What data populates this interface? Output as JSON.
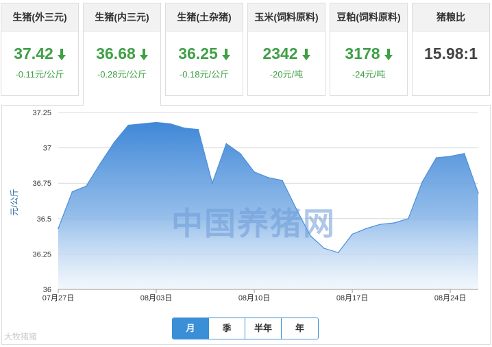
{
  "tiles": [
    {
      "label": "生猪(外三元)",
      "value": "37.42",
      "change": "-0.11元/公斤",
      "trend": "down"
    },
    {
      "label": "生猪(内三元)",
      "value": "36.68",
      "change": "-0.28元/公斤",
      "trend": "down",
      "active": true
    },
    {
      "label": "生猪(土杂猪)",
      "value": "36.25",
      "change": "-0.18元/公斤",
      "trend": "down"
    },
    {
      "label": "玉米(饲料原料)",
      "value": "2342",
      "change": "-20元/吨",
      "trend": "down"
    },
    {
      "label": "豆粕(饲料原料)",
      "value": "3178",
      "change": "-24元/吨",
      "trend": "down"
    },
    {
      "label": "猪粮比",
      "value": "15.98:1"
    }
  ],
  "colors": {
    "up_down_green": "#3fa046",
    "series_line": "#4a8fd8",
    "button_accent": "#3a8fd6"
  },
  "range_buttons": [
    {
      "label": "月",
      "active": true
    },
    {
      "label": "季",
      "active": false
    },
    {
      "label": "半年",
      "active": false
    },
    {
      "label": "年",
      "active": false
    }
  ],
  "watermark": "中国养猪网",
  "credit": "大牧猪猪",
  "chart_data": {
    "type": "area",
    "ylabel": "元/公斤",
    "ylim": [
      36,
      37.25
    ],
    "yticks": [
      "37.25",
      "37",
      "36.75",
      "36.5",
      "36.25",
      "36"
    ],
    "x_start": "07月27日",
    "x_end": "08月27日",
    "xticks": [
      "07月27日",
      "08月03日",
      "08月10日",
      "08月17日",
      "08月24日"
    ],
    "grid": true,
    "series": [
      {
        "values": [
          36.43,
          36.69,
          36.73,
          36.89,
          37.04,
          37.16,
          37.17,
          37.18,
          37.17,
          37.14,
          37.13,
          36.75,
          37.03,
          36.96,
          36.83,
          36.79,
          36.77,
          36.57,
          36.38,
          36.29,
          36.26,
          36.39,
          36.43,
          36.46,
          36.47,
          36.5,
          36.76,
          36.93,
          36.94,
          36.96,
          36.68
        ]
      }
    ]
  }
}
